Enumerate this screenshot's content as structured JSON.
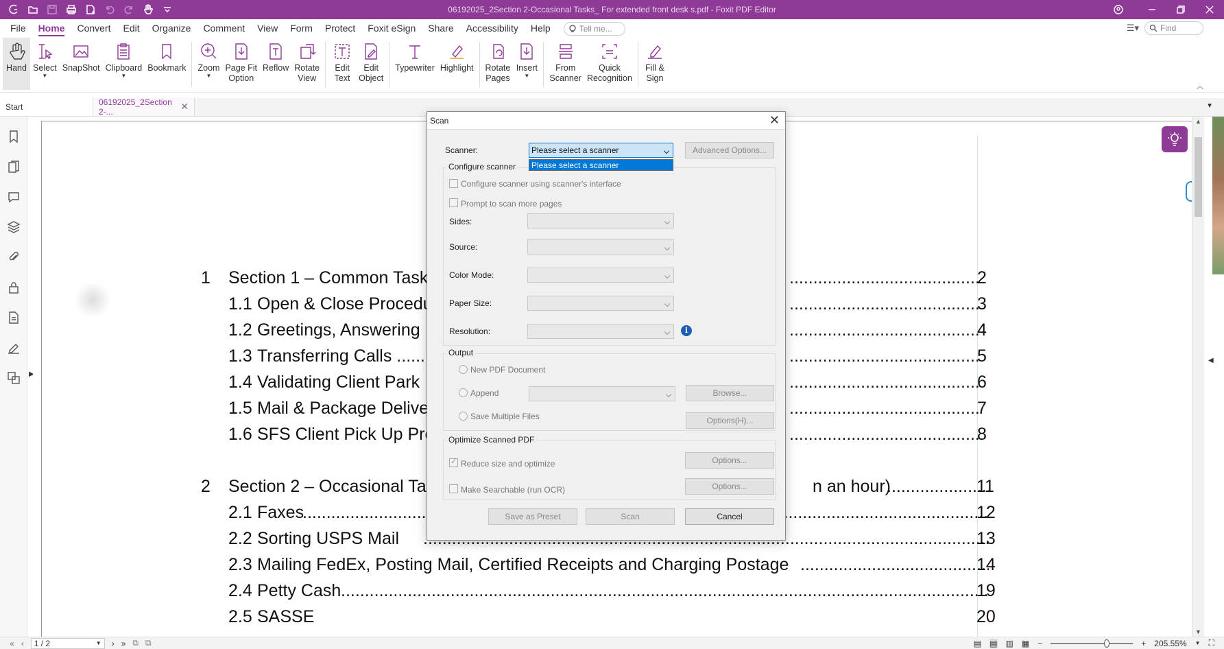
{
  "window": {
    "title": "06192025_2Section 2-Occasional Tasks_ For extended front  desk s.pdf - Foxit PDF Editor"
  },
  "menu": {
    "items": [
      "File",
      "Home",
      "Convert",
      "Edit",
      "Organize",
      "Comment",
      "View",
      "Form",
      "Protect",
      "Foxit eSign",
      "Share",
      "Accessibility",
      "Help"
    ],
    "tell_me_placeholder": "Tell me...",
    "find_placeholder": "Find"
  },
  "ribbon": {
    "hand": "Hand",
    "select": "Select",
    "snapshot": "SnapShot",
    "clipboard": "Clipboard",
    "bookmark": "Bookmark",
    "zoom": "Zoom",
    "page_fit": "Page Fit\nOption",
    "reflow": "Reflow",
    "rotate_view": "Rotate\nView",
    "edit_text": "Edit\nText",
    "edit_object": "Edit\nObject",
    "typewriter": "Typewriter",
    "highlight": "Highlight",
    "rotate_pages": "Rotate\nPages",
    "insert": "Insert",
    "from_scanner": "From\nScanner",
    "quick_recognition": "Quick\nRecognition",
    "fill_sign": "Fill &\nSign"
  },
  "tabs": {
    "start": "Start",
    "doc": "06192025_2Section 2-..."
  },
  "document": {
    "toc": [
      {
        "num": "1",
        "title": "Section 1 – Common Task",
        "page": "2"
      },
      {
        "num": "1.1",
        "title": "Open & Close Procedu",
        "page": "3"
      },
      {
        "num": "1.2",
        "title": "Greetings, Answering",
        "page": "4"
      },
      {
        "num": "1.3",
        "title": "Transferring Calls ......",
        "page": "5"
      },
      {
        "num": "1.4",
        "title": "Validating Client Park",
        "page": "6"
      },
      {
        "num": "1.5",
        "title": "Mail & Package Delive",
        "page": "7"
      },
      {
        "num": "1.6",
        "title": "SFS Client Pick Up Pro",
        "page": "8"
      },
      {
        "num": "2",
        "title": "Section 2 – Occasional Ta",
        "suffix": "n an hour)",
        "page": "11"
      },
      {
        "num": "2.1",
        "title": "Faxes",
        "page": "12"
      },
      {
        "num": "2.2",
        "title": "Sorting USPS Mail",
        "page": "13"
      },
      {
        "num": "2.3",
        "title": "Mailing FedEx, Posting Mail, Certified Receipts and Charging Postage",
        "page": "14"
      },
      {
        "num": "2.4",
        "title": "Petty Cash",
        "page": "19"
      },
      {
        "num": "2.5",
        "title": "SASSE",
        "page": "20"
      }
    ]
  },
  "dialog": {
    "title": "Scan",
    "scanner_label": "Scanner:",
    "scanner_value": "Please select a scanner",
    "scanner_option": "Please select a scanner",
    "advanced_options": "Advanced Options...",
    "configure_group": "Configure scanner",
    "configure_interface": "Configure scanner using scanner's interface",
    "prompt_more": "Prompt to scan more pages",
    "sides": "Sides:",
    "source": "Source:",
    "color_mode": "Color Mode:",
    "paper_size": "Paper Size:",
    "resolution": "Resolution:",
    "output_group": "Output",
    "new_pdf": "New PDF Document",
    "append": "Append",
    "browse": "Browse...",
    "save_multiple": "Save Multiple Files",
    "options_h": "Options(H)...",
    "optimize_group": "Optimize Scanned PDF",
    "reduce_size": "Reduce size and optimize",
    "options1": "Options...",
    "make_searchable": "Make Searchable (run OCR)",
    "options2": "Options...",
    "save_preset": "Save as Preset",
    "scan": "Scan",
    "cancel": "Cancel"
  },
  "status": {
    "page": "1 / 2",
    "zoom": "205.55%"
  }
}
